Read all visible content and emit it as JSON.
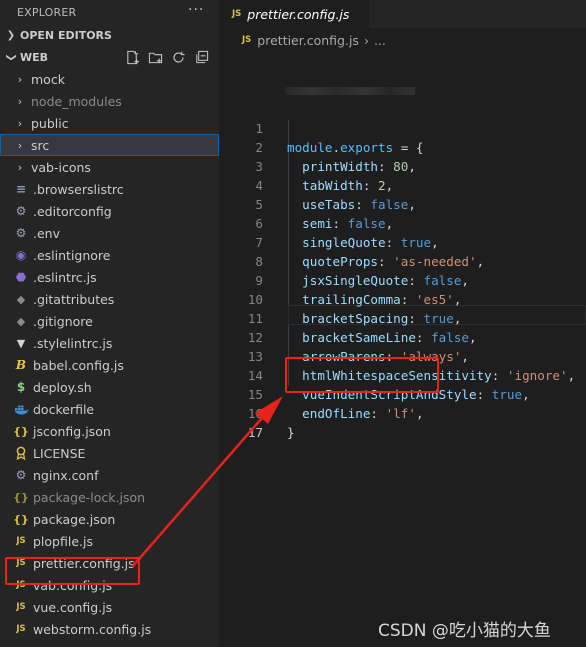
{
  "sidebar": {
    "title": "EXPLORER",
    "more_icon": "more-icon",
    "sections": {
      "open_editors": "OPEN EDITORS",
      "workspace": "WEB"
    },
    "actions": [
      "new-file-icon",
      "new-folder-icon",
      "refresh-icon",
      "collapse-all-icon"
    ],
    "items": [
      {
        "label": "mock",
        "type": "folder",
        "icon": "chevron-right-icon"
      },
      {
        "label": "node_modules",
        "type": "folder",
        "icon": "chevron-right-icon",
        "dim": true
      },
      {
        "label": "public",
        "type": "folder",
        "icon": "chevron-right-icon"
      },
      {
        "label": "src",
        "type": "folder",
        "icon": "chevron-right-icon",
        "selected": true
      },
      {
        "label": "vab-icons",
        "type": "folder",
        "icon": "chevron-right-icon"
      },
      {
        "label": ".browserslistrc",
        "type": "file",
        "icon": "lines-icon",
        "glyph": "≡"
      },
      {
        "label": ".editorconfig",
        "type": "file",
        "icon": "gear-icon",
        "glyph": "⚙"
      },
      {
        "label": ".env",
        "type": "file",
        "icon": "gear-icon",
        "glyph": "⚙"
      },
      {
        "label": ".eslintignore",
        "type": "file",
        "icon": "eslint-icon",
        "glyph": "◉"
      },
      {
        "label": ".eslintrc.js",
        "type": "file",
        "icon": "eslint-icon",
        "glyph": "⬣"
      },
      {
        "label": ".gitattributes",
        "type": "file",
        "icon": "git-icon",
        "glyph": "◆"
      },
      {
        "label": ".gitignore",
        "type": "file",
        "icon": "git-icon",
        "glyph": "◆"
      },
      {
        "label": ".stylelintrc.js",
        "type": "file",
        "icon": "stylelint-icon",
        "glyph": "▼"
      },
      {
        "label": "babel.config.js",
        "type": "file",
        "icon": "babel-icon",
        "glyph": "B"
      },
      {
        "label": "deploy.sh",
        "type": "file",
        "icon": "shell-icon",
        "glyph": "$"
      },
      {
        "label": "dockerfile",
        "type": "file",
        "icon": "docker-icon",
        "glyph": "🐳"
      },
      {
        "label": "jsconfig.json",
        "type": "file",
        "icon": "json-icon",
        "glyph": "{}"
      },
      {
        "label": "LICENSE",
        "type": "file",
        "icon": "license-icon",
        "glyph": "🎗"
      },
      {
        "label": "nginx.conf",
        "type": "file",
        "icon": "gear-icon",
        "glyph": "⚙"
      },
      {
        "label": "package-lock.json",
        "type": "file",
        "icon": "json-icon",
        "glyph": "{}",
        "dim": true
      },
      {
        "label": "package.json",
        "type": "file",
        "icon": "json-icon",
        "glyph": "{}"
      },
      {
        "label": "plopfile.js",
        "type": "file",
        "icon": "js-icon",
        "glyph": "JS"
      },
      {
        "label": "prettier.config.js",
        "type": "file",
        "icon": "js-icon",
        "glyph": "JS",
        "highlighted": true
      },
      {
        "label": "vab.config.js",
        "type": "file",
        "icon": "js-icon",
        "glyph": "JS"
      },
      {
        "label": "vue.config.js",
        "type": "file",
        "icon": "js-icon",
        "glyph": "JS"
      },
      {
        "label": "webstorm.config.js",
        "type": "file",
        "icon": "js-icon",
        "glyph": "JS"
      }
    ]
  },
  "editor": {
    "tab": {
      "label": "prettier.config.js",
      "icon": "js-icon",
      "glyph": "JS"
    },
    "breadcrumb": {
      "file": "prettier.config.js",
      "sep": "›",
      "more": "..."
    },
    "lines": [
      {
        "n": "1"
      },
      {
        "n": "2"
      },
      {
        "n": "3"
      },
      {
        "n": "4"
      },
      {
        "n": "5"
      },
      {
        "n": "6"
      },
      {
        "n": "7"
      },
      {
        "n": "8"
      },
      {
        "n": "9"
      },
      {
        "n": "10"
      },
      {
        "n": "11"
      },
      {
        "n": "12"
      },
      {
        "n": "13"
      },
      {
        "n": "14"
      },
      {
        "n": "15"
      },
      {
        "n": "16"
      },
      {
        "n": "17"
      }
    ],
    "code": {
      "l1": {
        "module": "module",
        "dot": ".",
        "exports": "exports",
        "eq": " = {"
      },
      "l2": {
        "key": "printWidth",
        "sep": ": ",
        "val": "80",
        "end": ","
      },
      "l3": {
        "key": "tabWidth",
        "sep": ": ",
        "val": "2",
        "end": ","
      },
      "l4": {
        "key": "useTabs",
        "sep": ": ",
        "val": "false",
        "end": ","
      },
      "l5": {
        "key": "semi",
        "sep": ": ",
        "val": "false",
        "end": ","
      },
      "l6": {
        "key": "singleQuote",
        "sep": ": ",
        "val": "true",
        "end": ","
      },
      "l7": {
        "key": "quoteProps",
        "sep": ": ",
        "val": "'as-needed'",
        "end": ","
      },
      "l8": {
        "key": "jsxSingleQuote",
        "sep": ": ",
        "val": "false",
        "end": ","
      },
      "l9": {
        "key": "trailingComma",
        "sep": ": ",
        "val": "'es5'",
        "end": ","
      },
      "l10": {
        "key": "bracketSpacing",
        "sep": ": ",
        "val": "true",
        "end": ","
      },
      "l11": {
        "key": "bracketSameLine",
        "sep": ": ",
        "val": "false",
        "end": ","
      },
      "l12": {
        "key": "arrowParens",
        "sep": ": ",
        "val": "'always'",
        "end": ","
      },
      "l13": {
        "key": "htmlWhitespaceSensitivity",
        "sep": ": ",
        "val": "'ignore'",
        "end": ","
      },
      "l14": {
        "key": "vueIndentScriptAndStyle",
        "sep": ": ",
        "val": "true",
        "end": ","
      },
      "l15": {
        "key": "endOfLine",
        "sep": ": ",
        "val": "'lf'",
        "end": ","
      },
      "l16": {
        "close": "}"
      }
    }
  },
  "annotation": {
    "color": "#e8231c",
    "watermark": "CSDN @吃小猫的大鱼"
  }
}
